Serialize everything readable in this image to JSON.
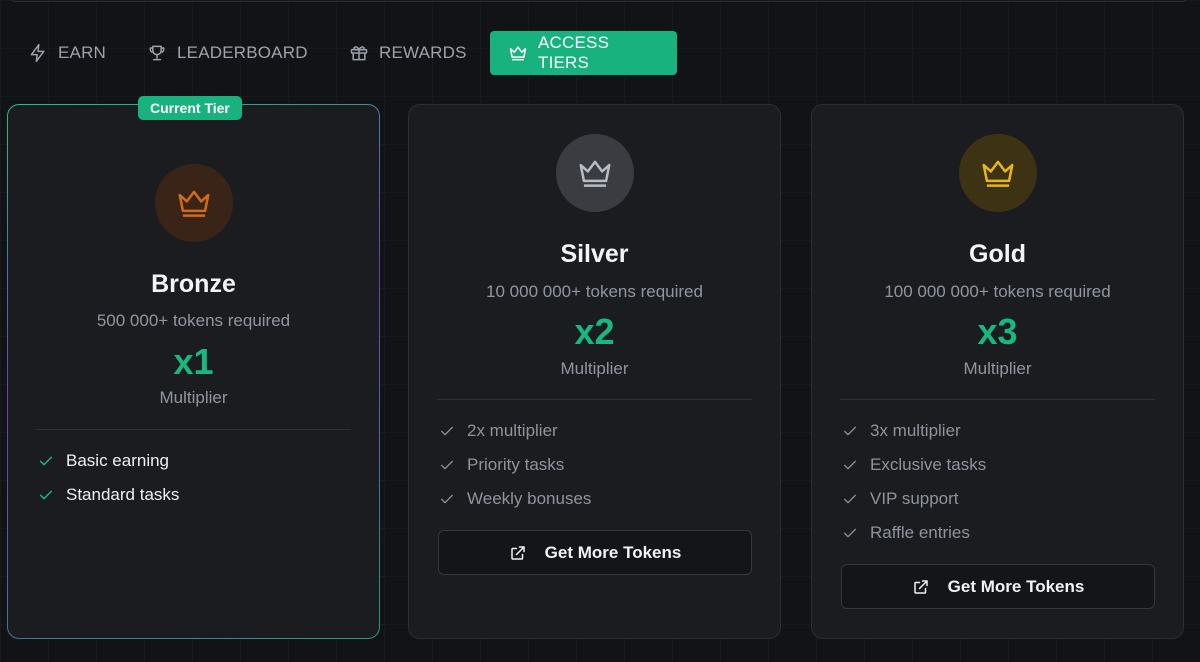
{
  "tabs": [
    {
      "label": "EARN",
      "icon": "lightning-icon",
      "active": false
    },
    {
      "label": "LEADERBOARD",
      "icon": "trophy-icon",
      "active": false
    },
    {
      "label": "REWARDS",
      "icon": "gift-icon",
      "active": false
    },
    {
      "label": "ACCESS TIERS",
      "icon": "crown-icon",
      "active": true
    }
  ],
  "colors": {
    "accent": "#17b27d",
    "bronze": "#c8661a",
    "silver": "#b7bcc4",
    "gold": "#e8b618"
  },
  "tiers": [
    {
      "badge": "Current Tier",
      "name": "Bronze",
      "requirement": "500 000+ tokens required",
      "multiplier": "x1",
      "multiplier_label": "Multiplier",
      "features": [
        "Basic earning",
        "Standard tasks"
      ]
    },
    {
      "name": "Silver",
      "requirement": "10 000 000+ tokens required",
      "multiplier": "x2",
      "multiplier_label": "Multiplier",
      "features": [
        "2x multiplier",
        "Priority tasks",
        "Weekly bonuses"
      ],
      "button": "Get More Tokens"
    },
    {
      "name": "Gold",
      "requirement": "100 000 000+ tokens required",
      "multiplier": "x3",
      "multiplier_label": "Multiplier",
      "features": [
        "3x multiplier",
        "Exclusive tasks",
        "VIP support",
        "Raffle entries"
      ],
      "button": "Get More Tokens"
    }
  ]
}
